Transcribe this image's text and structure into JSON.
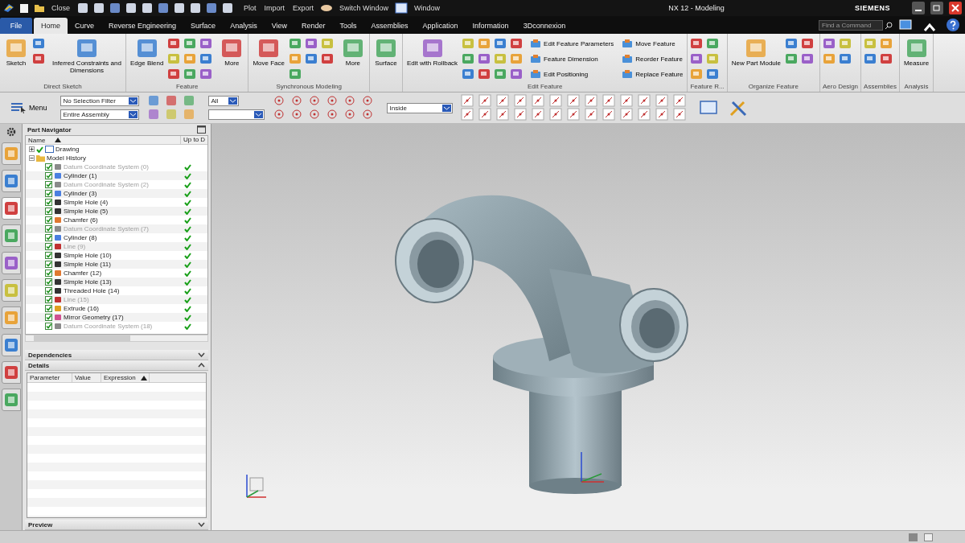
{
  "quick_access": [
    {
      "label": "Close"
    },
    {
      "label": "Plot"
    },
    {
      "label": "Import"
    },
    {
      "label": "Export"
    },
    {
      "label": "Switch Window"
    },
    {
      "label": "Window"
    }
  ],
  "window": {
    "title": "NX 12 - Modeling",
    "brand": "SIEMENS"
  },
  "tabs": [
    {
      "label": "File",
      "selected": false,
      "kind": "file"
    },
    {
      "label": "Home",
      "selected": true,
      "kind": "tab"
    },
    {
      "label": "Curve",
      "selected": false,
      "kind": "tab"
    },
    {
      "label": "Reverse Engineering",
      "selected": false,
      "kind": "tab"
    },
    {
      "label": "Surface",
      "selected": false,
      "kind": "tab"
    },
    {
      "label": "Analysis",
      "selected": false,
      "kind": "tab"
    },
    {
      "label": "View",
      "selected": false,
      "kind": "tab"
    },
    {
      "label": "Render",
      "selected": false,
      "kind": "tab"
    },
    {
      "label": "Tools",
      "selected": false,
      "kind": "tab"
    },
    {
      "label": "Assemblies",
      "selected": false,
      "kind": "tab"
    },
    {
      "label": "Application",
      "selected": false,
      "kind": "tab"
    },
    {
      "label": "Information",
      "selected": false,
      "kind": "tab"
    },
    {
      "label": "3Dconnexion",
      "selected": false,
      "kind": "tab"
    }
  ],
  "search": {
    "placeholder": "Find a Command"
  },
  "ribbon": [
    {
      "label": "Direct Sketch",
      "buttons": [
        {
          "label": "Sketch",
          "kind": "large"
        },
        {
          "label": "Inferred Constraints and Dimensions",
          "kind": "large"
        }
      ]
    },
    {
      "label": "Feature",
      "buttons": [
        {
          "label": "Edge Blend",
          "kind": "large"
        },
        {
          "label": "More",
          "kind": "large"
        }
      ]
    },
    {
      "label": "Synchronous Modeling",
      "buttons": [
        {
          "label": "Move Face",
          "kind": "large"
        },
        {
          "label": "More",
          "kind": "large"
        }
      ]
    },
    {
      "buttons": [
        {
          "label": "Surface",
          "kind": "large"
        }
      ]
    },
    {
      "label": "Edit Feature",
      "buttons": [
        {
          "label": "Edit with Rollback",
          "kind": "large"
        },
        {
          "label": "Edit Feature Parameters",
          "kind": "row"
        },
        {
          "label": "Feature Dimension",
          "kind": "row"
        },
        {
          "label": "Edit Positioning",
          "kind": "row"
        },
        {
          "label": "Move Feature",
          "kind": "row"
        },
        {
          "label": "Reorder Feature",
          "kind": "row"
        },
        {
          "label": "Replace Feature",
          "kind": "row"
        }
      ]
    },
    {
      "label": "Feature R..."
    },
    {
      "label": "Organize Feature",
      "buttons": [
        {
          "label": "New Part Module",
          "kind": "large"
        }
      ]
    },
    {
      "label": "Aero Design"
    },
    {
      "label": "Assemblies"
    },
    {
      "label": "Analysis",
      "buttons": [
        {
          "label": "Measure",
          "kind": "large"
        }
      ]
    }
  ],
  "toolbar": {
    "menu": "Menu",
    "filters": [
      {
        "value": "No Selection Filter"
      },
      {
        "value": "Entire Assembly"
      }
    ],
    "scope": {
      "value": "All"
    },
    "snap_mode": {
      "value": "Inside"
    }
  },
  "part_navigator": {
    "title": "Part Navigator",
    "columns": [
      "Name",
      "Up to D"
    ],
    "tree": [
      {
        "label": "Drawing",
        "expanded": false,
        "checked": true
      },
      {
        "label": "Model History",
        "expanded": true,
        "children": [
          {
            "label": "Datum Coordinate System (0)",
            "kind": "datum",
            "dimmed": true,
            "checked": true,
            "up_to_date": true
          },
          {
            "label": "Cylinder (1)",
            "kind": "cylinder",
            "dimmed": false,
            "checked": true,
            "up_to_date": true
          },
          {
            "label": "Datum Coordinate System (2)",
            "kind": "datum",
            "dimmed": true,
            "checked": true,
            "up_to_date": true
          },
          {
            "label": "Cylinder (3)",
            "kind": "cylinder",
            "dimmed": false,
            "checked": true,
            "up_to_date": true
          },
          {
            "label": "Simple Hole (4)",
            "kind": "hole",
            "dimmed": false,
            "checked": true,
            "up_to_date": true
          },
          {
            "label": "Simple Hole (5)",
            "kind": "hole",
            "dimmed": false,
            "checked": true,
            "up_to_date": true
          },
          {
            "label": "Chamfer (6)",
            "kind": "chamfer",
            "dimmed": false,
            "checked": true,
            "up_to_date": true
          },
          {
            "label": "Datum Coordinate System (7)",
            "kind": "datum",
            "dimmed": true,
            "checked": true,
            "up_to_date": true
          },
          {
            "label": "Cylinder (8)",
            "kind": "cylinder",
            "dimmed": false,
            "checked": true,
            "up_to_date": true
          },
          {
            "label": "Line (9)",
            "kind": "line",
            "dimmed": true,
            "checked": true,
            "up_to_date": true
          },
          {
            "label": "Simple Hole (10)",
            "kind": "hole",
            "dimmed": false,
            "checked": true,
            "up_to_date": true
          },
          {
            "label": "Simple Hole (11)",
            "kind": "hole",
            "dimmed": false,
            "checked": true,
            "up_to_date": true
          },
          {
            "label": "Chamfer (12)",
            "kind": "chamfer",
            "dimmed": false,
            "checked": true,
            "up_to_date": true
          },
          {
            "label": "Simple Hole (13)",
            "kind": "hole",
            "dimmed": false,
            "checked": true,
            "up_to_date": true
          },
          {
            "label": "Threaded Hole (14)",
            "kind": "hole",
            "dimmed": false,
            "checked": true,
            "up_to_date": true
          },
          {
            "label": "Line (15)",
            "kind": "line",
            "dimmed": true,
            "checked": true,
            "up_to_date": true
          },
          {
            "label": "Extrude (16)",
            "kind": "extrude",
            "dimmed": false,
            "checked": true,
            "up_to_date": true
          },
          {
            "label": "Mirror Geometry (17)",
            "kind": "mirror",
            "dimmed": false,
            "checked": true,
            "up_to_date": true
          },
          {
            "label": "Datum Coordinate System (18)",
            "kind": "datum",
            "dimmed": true,
            "checked": true,
            "up_to_date": true
          }
        ]
      }
    ]
  },
  "panels": [
    {
      "title": "Dependencies",
      "expanded": false
    },
    {
      "title": "Details",
      "expanded": true,
      "columns": [
        "Parameter",
        "Value",
        "Expression"
      ]
    },
    {
      "title": "Preview",
      "expanded": false
    }
  ]
}
